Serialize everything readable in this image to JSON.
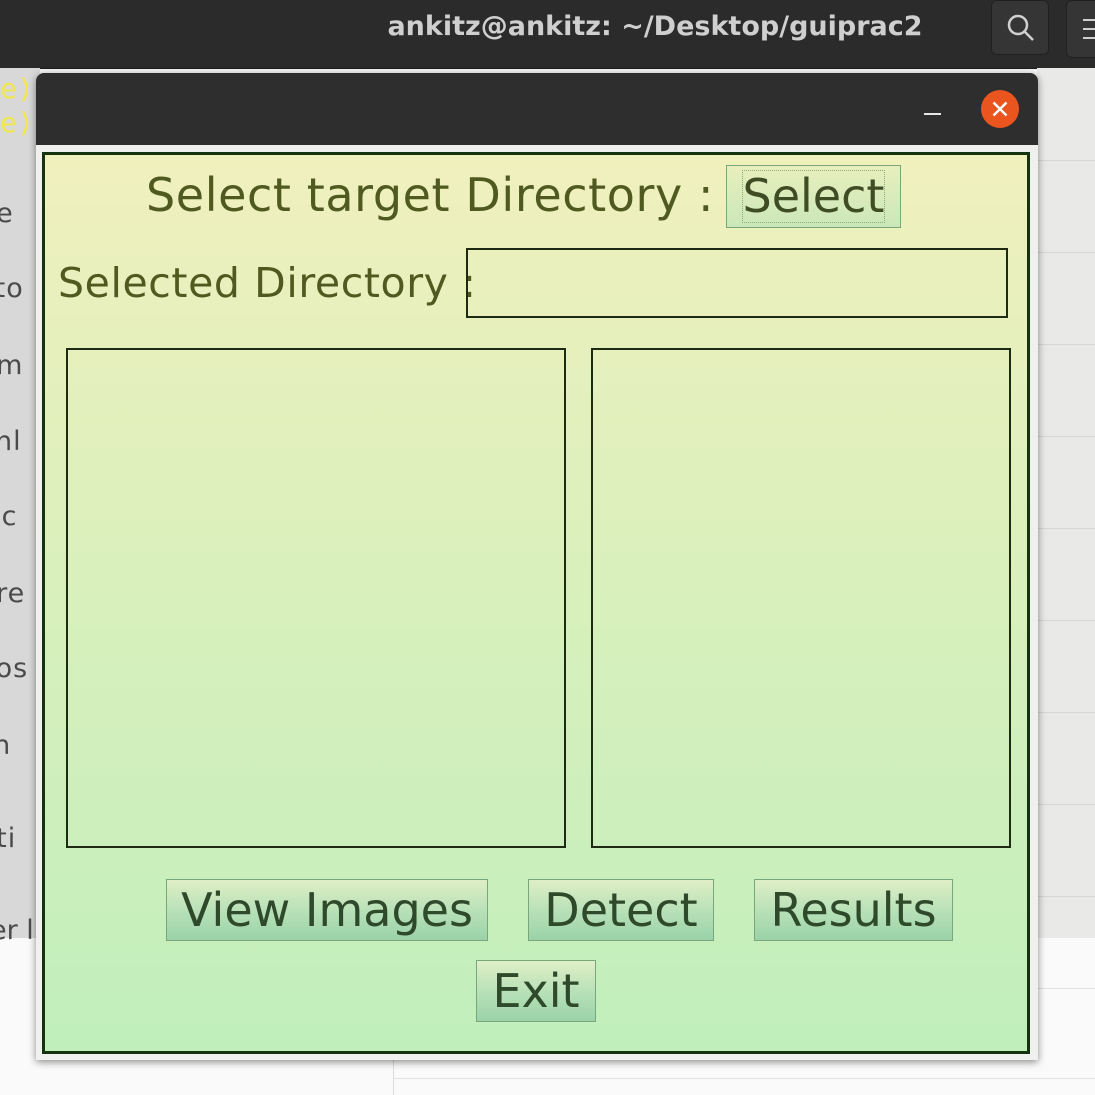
{
  "background": {
    "window_title": "ankitz@ankitz: ~/Desktop/guiprac2",
    "terminal_lines": [
      "e)",
      "e)"
    ],
    "sidebar_fragments": [
      "ne",
      "kto",
      "um",
      "vnl",
      "sic",
      "ure",
      "eos",
      "sh",
      "uti"
    ],
    "bottom_fragment": "er l"
  },
  "app": {
    "select_label": "Select target Directory :",
    "select_button": "Select",
    "selected_label": "Selected Directory :",
    "selected_directory_value": "",
    "buttons": {
      "view_images": "View Images",
      "detect": "Detect",
      "results": "Results",
      "exit": "Exit"
    }
  },
  "colors": {
    "gradient_top": "#f0f0bd",
    "gradient_bottom": "#c0efbc",
    "label_text": "#505a20",
    "close_button": "#e9541f"
  }
}
